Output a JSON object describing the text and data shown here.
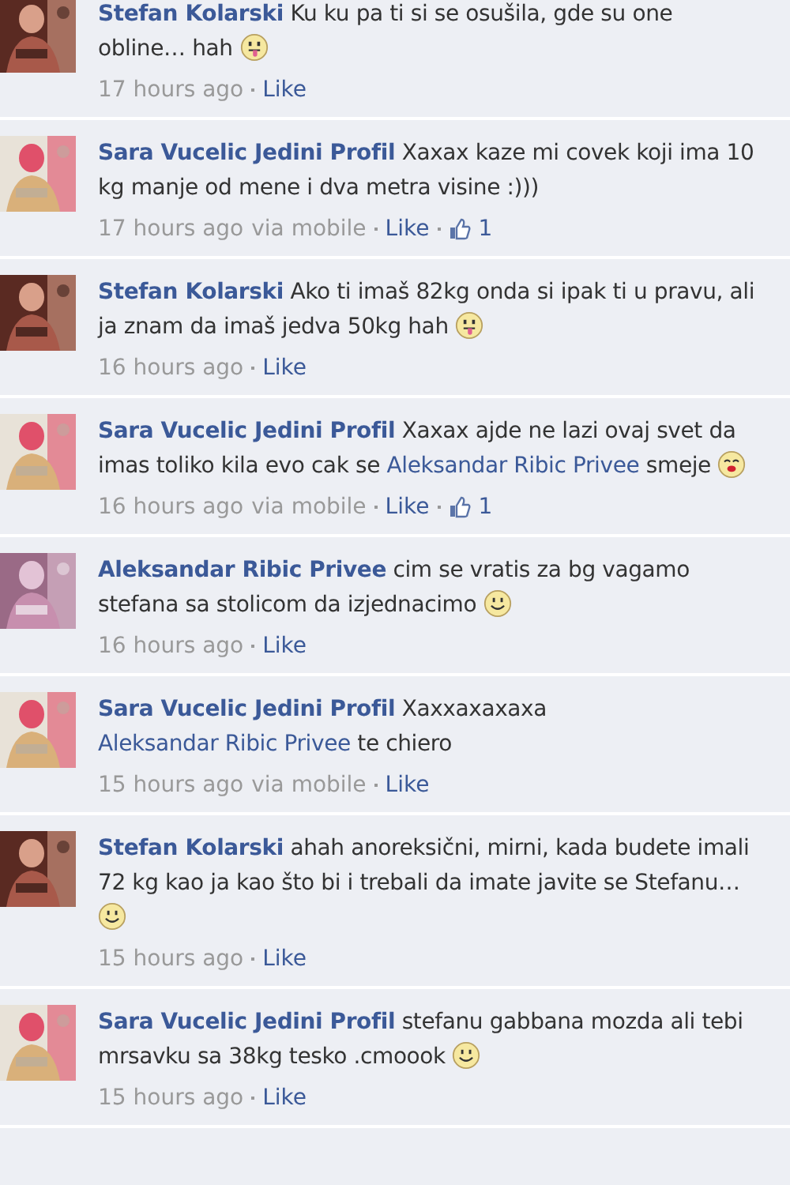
{
  "comments": [
    {
      "author": "Stefan Kolarski",
      "avatar": {
        "kind": "picture"
      },
      "body": [
        {
          "kind": "text",
          "text": "Ku ku pa ti si se osušila, gde su one obline… hah"
        },
        {
          "kind": "tongue"
        }
      ],
      "time": "17 hours ago",
      "like": "Like"
    },
    {
      "author": "Sara Vucelic Jedini Profil",
      "avatar": {
        "kind": "picture"
      },
      "body": [
        {
          "kind": "text",
          "text": "Xaxax kaze mi covek koji ima 10 kg manje od mene i dva metra visine :)))"
        }
      ],
      "time": "17 hours ago",
      "via": "via mobile",
      "like": "Like",
      "likes": "1"
    },
    {
      "author": "Stefan Kolarski",
      "avatar": {
        "kind": "picture"
      },
      "body": [
        {
          "kind": "text",
          "text": "Ako ti imaš 82kg onda si ipak ti u pravu, ali ja znam da imaš jedva 50kg hah"
        },
        {
          "kind": "tongue"
        }
      ],
      "time": "16 hours ago",
      "like": "Like"
    },
    {
      "author": "Sara Vucelic Jedini Profil",
      "avatar": {
        "kind": "picture"
      },
      "body": [
        {
          "kind": "text",
          "text": "Xaxax ajde ne lazi ovaj svet da imas toliko kila evo cak se"
        },
        {
          "kind": "mention",
          "text": "Aleksandar Ribic Privee"
        },
        {
          "kind": "text",
          "text": "smeje"
        },
        {
          "kind": "kiss"
        }
      ],
      "time": "16 hours ago",
      "via": "via mobile",
      "like": "Like",
      "likes": "1"
    },
    {
      "author": "Aleksandar Ribic Privee",
      "avatar": {
        "kind": "picture"
      },
      "body": [
        {
          "kind": "text",
          "text": "cim se vratis za bg vagamo stefana sa stolicom da izjednacimo"
        },
        {
          "kind": "smile"
        }
      ],
      "time": "16 hours ago",
      "like": "Like"
    },
    {
      "author": "Sara Vucelic Jedini Profil",
      "avatar": {
        "kind": "picture"
      },
      "body": [
        {
          "kind": "text",
          "text": "Xaxxaxaxaxa"
        },
        {
          "kind": "mention",
          "text": "Aleksandar Ribic Privee"
        },
        {
          "kind": "text",
          "text": "te chiero"
        }
      ],
      "time": "15 hours ago",
      "via": "via mobile",
      "like": "Like"
    },
    {
      "author": "Stefan Kolarski",
      "avatar": {
        "kind": "picture"
      },
      "body": [
        {
          "kind": "text",
          "text": "ahah anoreksični, mirni, kada budete imali 72 kg kao ja kao što bi i trebali da imate javite se Stefanu…"
        },
        {
          "kind": "smile"
        }
      ],
      "time": "15 hours ago",
      "like": "Like"
    },
    {
      "author": "Sara Vucelic Jedini Profil",
      "avatar": {
        "kind": "picture"
      },
      "body": [
        {
          "kind": "text",
          "text": "stefanu gabbana mozda ali tebi mrsavku sa 38kg tesko .cmoook"
        },
        {
          "kind": "smile"
        }
      ],
      "time": "15 hours ago",
      "like": "Like"
    }
  ]
}
